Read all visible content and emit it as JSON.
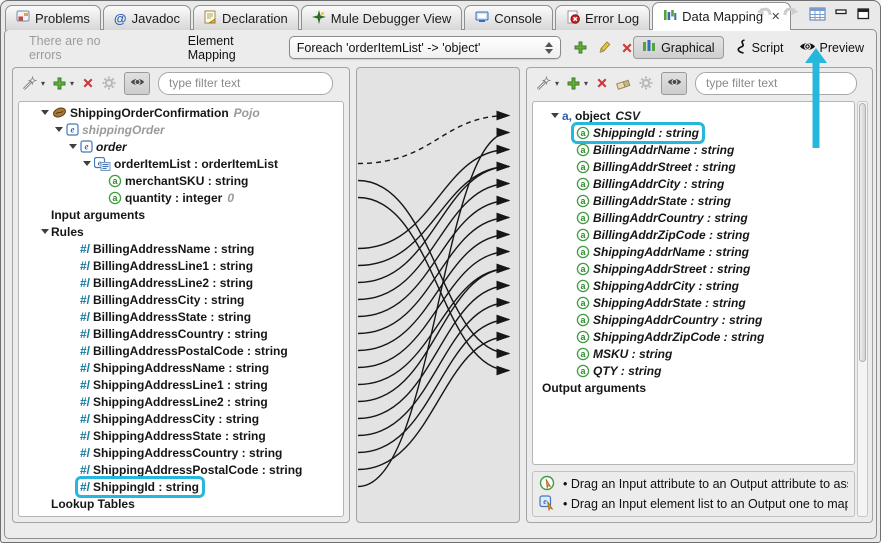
{
  "tabs": [
    {
      "label": "Problems",
      "icon": "problems"
    },
    {
      "label": "Javadoc",
      "icon": "javadoc"
    },
    {
      "label": "Declaration",
      "icon": "declaration"
    },
    {
      "label": "Mule Debugger View",
      "icon": "mule-debugger"
    },
    {
      "label": "Console",
      "icon": "console"
    },
    {
      "label": "Error Log",
      "icon": "error-log"
    },
    {
      "label": "Data Mapping",
      "icon": "data-mapping",
      "active": true,
      "close_glyph": "✕"
    }
  ],
  "toolbar": {
    "status": "There are no errors",
    "element_mapping_label": "Element Mapping",
    "combo_value": "Foreach 'orderItemList' -> 'object'",
    "view_buttons": {
      "graphical": "Graphical",
      "script": "Script",
      "preview": "Preview"
    }
  },
  "input_panel": {
    "filter_placeholder": "type filter text",
    "rows": [
      {
        "id": "L_root",
        "icon": "bean",
        "expander": true,
        "indent": 0,
        "label": "ShippingOrderConfirmation",
        "suffix": "Pojo",
        "suffixCls": "gray-italic"
      },
      {
        "id": "L_shippingOrder",
        "icon": "element",
        "expander": true,
        "indent": 1,
        "label": "shippingOrder",
        "cls": "gray-italic"
      },
      {
        "id": "L_order",
        "icon": "element",
        "expander": true,
        "indent": 2,
        "label": "order",
        "cls": "italic"
      },
      {
        "id": "L_orderItemList",
        "icon": "element-list",
        "expander": true,
        "indent": 3,
        "label": "orderItemList : orderItemList"
      },
      {
        "id": "L_merchantSKU",
        "icon": "attribute",
        "indent": 4,
        "label": "merchantSKU : string"
      },
      {
        "id": "L_quantity",
        "icon": "attribute",
        "indent": 4,
        "label": "quantity : integer",
        "suffix": "0",
        "suffixCls": "gray-italic"
      },
      {
        "id": "L_inputArguments",
        "indent": 0,
        "label": "Input arguments"
      },
      {
        "id": "L_rules",
        "expander": true,
        "indent": 0,
        "label": "Rules"
      },
      {
        "id": "L_BillingAddressName",
        "icon": "rule",
        "indent": 2,
        "label": "BillingAddressName : string"
      },
      {
        "id": "L_BillingAddressLine1",
        "icon": "rule",
        "indent": 2,
        "label": "BillingAddressLine1 : string"
      },
      {
        "id": "L_BillingAddressLine2",
        "icon": "rule",
        "indent": 2,
        "label": "BillingAddressLine2 : string"
      },
      {
        "id": "L_BillingAddressCity",
        "icon": "rule",
        "indent": 2,
        "label": "BillingAddressCity : string"
      },
      {
        "id": "L_BillingAddressState",
        "icon": "rule",
        "indent": 2,
        "label": "BillingAddressState : string"
      },
      {
        "id": "L_BillingAddressCountry",
        "icon": "rule",
        "indent": 2,
        "label": "BillingAddressCountry : string"
      },
      {
        "id": "L_BillingAddressPostalCode",
        "icon": "rule",
        "indent": 2,
        "label": "BillingAddressPostalCode : string"
      },
      {
        "id": "L_ShippingAddressName",
        "icon": "rule",
        "indent": 2,
        "label": "ShippingAddressName : string"
      },
      {
        "id": "L_ShippingAddressLine1",
        "icon": "rule",
        "indent": 2,
        "label": "ShippingAddressLine1 : string"
      },
      {
        "id": "L_ShippingAddressLine2",
        "icon": "rule",
        "indent": 2,
        "label": "ShippingAddressLine2 : string"
      },
      {
        "id": "L_ShippingAddressCity",
        "icon": "rule",
        "indent": 2,
        "label": "ShippingAddressCity : string"
      },
      {
        "id": "L_ShippingAddressState",
        "icon": "rule",
        "indent": 2,
        "label": "ShippingAddressState : string"
      },
      {
        "id": "L_ShippingAddressCountry",
        "icon": "rule",
        "indent": 2,
        "label": "ShippingAddressCountry : string"
      },
      {
        "id": "L_ShippingAddressPostalCode",
        "icon": "rule",
        "indent": 2,
        "label": "ShippingAddressPostalCode : string"
      },
      {
        "id": "L_ShippingId",
        "icon": "rule",
        "indent": 2,
        "label": "ShippingId : string",
        "hl": true
      },
      {
        "id": "L_lookupTables",
        "indent": 0,
        "label": "Lookup Tables"
      }
    ]
  },
  "output_panel": {
    "filter_placeholder": "type filter text",
    "rows": [
      {
        "id": "R_object",
        "icon": "attr-group",
        "expander": true,
        "indent": 0,
        "label": "object",
        "suffix": "CSV",
        "suffixCls": "italic"
      },
      {
        "id": "R_ShippingId",
        "icon": "attribute",
        "indent": 1,
        "label": "ShippingId : string",
        "cls": "italic",
        "hl": true
      },
      {
        "id": "R_BillingAddrName",
        "icon": "attribute",
        "indent": 1,
        "label": "BillingAddrName : string",
        "cls": "italic"
      },
      {
        "id": "R_BillingAddrStreet",
        "icon": "attribute",
        "indent": 1,
        "label": "BillingAddrStreet : string",
        "cls": "italic"
      },
      {
        "id": "R_BillingAddrCity",
        "icon": "attribute",
        "indent": 1,
        "label": "BillingAddrCity : string",
        "cls": "italic"
      },
      {
        "id": "R_BillingAddrState",
        "icon": "attribute",
        "indent": 1,
        "label": "BillingAddrState : string",
        "cls": "italic"
      },
      {
        "id": "R_BillingAddrCountry",
        "icon": "attribute",
        "indent": 1,
        "label": "BillingAddrCountry : string",
        "cls": "italic"
      },
      {
        "id": "R_BillingAddrZipCode",
        "icon": "attribute",
        "indent": 1,
        "label": "BillingAddrZipCode : string",
        "cls": "italic"
      },
      {
        "id": "R_ShippingAddrName",
        "icon": "attribute",
        "indent": 1,
        "label": "ShippingAddrName : string",
        "cls": "italic"
      },
      {
        "id": "R_ShippingAddrStreet",
        "icon": "attribute",
        "indent": 1,
        "label": "ShippingAddrStreet : string",
        "cls": "italic"
      },
      {
        "id": "R_ShippingAddrCity",
        "icon": "attribute",
        "indent": 1,
        "label": "ShippingAddrCity : string",
        "cls": "italic"
      },
      {
        "id": "R_ShippingAddrState",
        "icon": "attribute",
        "indent": 1,
        "label": "ShippingAddrState : string",
        "cls": "italic"
      },
      {
        "id": "R_ShippingAddrCountry",
        "icon": "attribute",
        "indent": 1,
        "label": "ShippingAddrCountry : string",
        "cls": "italic"
      },
      {
        "id": "R_ShippingAddrZipCode",
        "icon": "attribute",
        "indent": 1,
        "label": "ShippingAddrZipCode : string",
        "cls": "italic"
      },
      {
        "id": "R_MSKU",
        "icon": "attribute",
        "indent": 1,
        "label": "MSKU : string",
        "cls": "italic"
      },
      {
        "id": "R_QTY",
        "icon": "attribute",
        "indent": 1,
        "label": "QTY : string",
        "cls": "italic"
      },
      {
        "id": "R_outputArguments",
        "indent": 0,
        "flush": true,
        "label": "Output arguments"
      }
    ],
    "hints": [
      {
        "icon": "hint-attribute",
        "text": "• Drag an Input attribute to an Output attribute to assig"
      },
      {
        "icon": "hint-element",
        "text": "• Drag an Input element list to an Output one to map th"
      }
    ]
  },
  "connections": [
    {
      "from": "L_orderItemList",
      "to": "R_object",
      "dashed": true
    },
    {
      "from": "L_merchantSKU",
      "to": "R_MSKU"
    },
    {
      "from": "L_quantity",
      "to": "R_QTY"
    },
    {
      "from": "L_BillingAddressName",
      "to": "R_BillingAddrName"
    },
    {
      "from": "L_BillingAddressLine1",
      "to": "R_BillingAddrStreet"
    },
    {
      "from": "L_BillingAddressLine2",
      "to": "R_BillingAddrStreet"
    },
    {
      "from": "L_BillingAddressCity",
      "to": "R_BillingAddrCity"
    },
    {
      "from": "L_BillingAddressState",
      "to": "R_BillingAddrState"
    },
    {
      "from": "L_BillingAddressCountry",
      "to": "R_BillingAddrCountry"
    },
    {
      "from": "L_BillingAddressPostalCode",
      "to": "R_BillingAddrZipCode"
    },
    {
      "from": "L_ShippingAddressName",
      "to": "R_ShippingAddrName"
    },
    {
      "from": "L_ShippingAddressLine1",
      "to": "R_ShippingAddrStreet"
    },
    {
      "from": "L_ShippingAddressLine2",
      "to": "R_ShippingAddrStreet"
    },
    {
      "from": "L_ShippingAddressCity",
      "to": "R_ShippingAddrCity"
    },
    {
      "from": "L_ShippingAddressState",
      "to": "R_ShippingAddrState"
    },
    {
      "from": "L_ShippingAddressCountry",
      "to": "R_ShippingAddrCountry"
    },
    {
      "from": "L_ShippingAddressPostalCode",
      "to": "R_ShippingAddrZipCode"
    },
    {
      "from": "L_ShippingId",
      "to": "R_ShippingId"
    }
  ],
  "annotations": {
    "highlight_color": "#27b7dc"
  }
}
